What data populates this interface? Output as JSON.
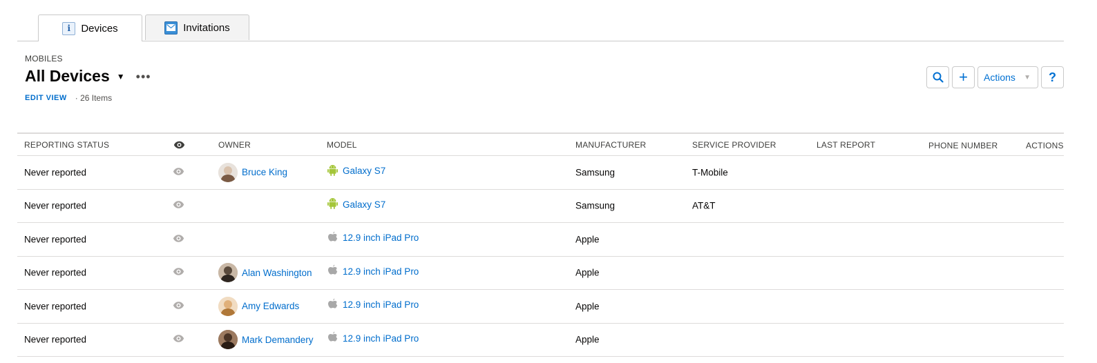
{
  "tabs": [
    {
      "label": "Devices",
      "icon": "info-icon",
      "active": true
    },
    {
      "label": "Invitations",
      "icon": "envelope-icon",
      "active": false
    }
  ],
  "header": {
    "eyebrow": "MOBILES",
    "title": "All Devices",
    "edit_view": "EDIT VIEW",
    "items_count": "· 26 Items"
  },
  "toolbar": {
    "actions_label": "Actions",
    "help_label": "?",
    "add_label": "+"
  },
  "table": {
    "columns": [
      "REPORTING STATUS",
      "",
      "OWNER",
      "MODEL",
      "MANUFACTURER",
      "SERVICE PROVIDER",
      "LAST REPORT",
      "PHONE NUMBER",
      "ACTIONS"
    ],
    "rows": [
      {
        "status": "Never reported",
        "owner": "Bruce King",
        "model": "Galaxy S7",
        "platform": "android",
        "manufacturer": "Samsung",
        "provider": "T-Mobile"
      },
      {
        "status": "Never reported",
        "owner": "",
        "model": "Galaxy S7",
        "platform": "android",
        "manufacturer": "Samsung",
        "provider": "AT&T"
      },
      {
        "status": "Never reported",
        "owner": "",
        "model": "12.9 inch iPad Pro",
        "platform": "apple",
        "manufacturer": "Apple",
        "provider": ""
      },
      {
        "status": "Never reported",
        "owner": "Alan Washington",
        "model": "12.9 inch iPad Pro",
        "platform": "apple",
        "manufacturer": "Apple",
        "provider": ""
      },
      {
        "status": "Never reported",
        "owner": "Amy Edwards",
        "model": "12.9 inch iPad Pro",
        "platform": "apple",
        "manufacturer": "Apple",
        "provider": ""
      },
      {
        "status": "Never reported",
        "owner": "Mark Demandery",
        "model": "12.9 inch iPad Pro",
        "platform": "apple",
        "manufacturer": "Apple",
        "provider": ""
      }
    ]
  },
  "colors": {
    "link": "#006dcc",
    "android": "#a4c639",
    "apple": "#a8a8a8",
    "border": "#dddbda"
  }
}
